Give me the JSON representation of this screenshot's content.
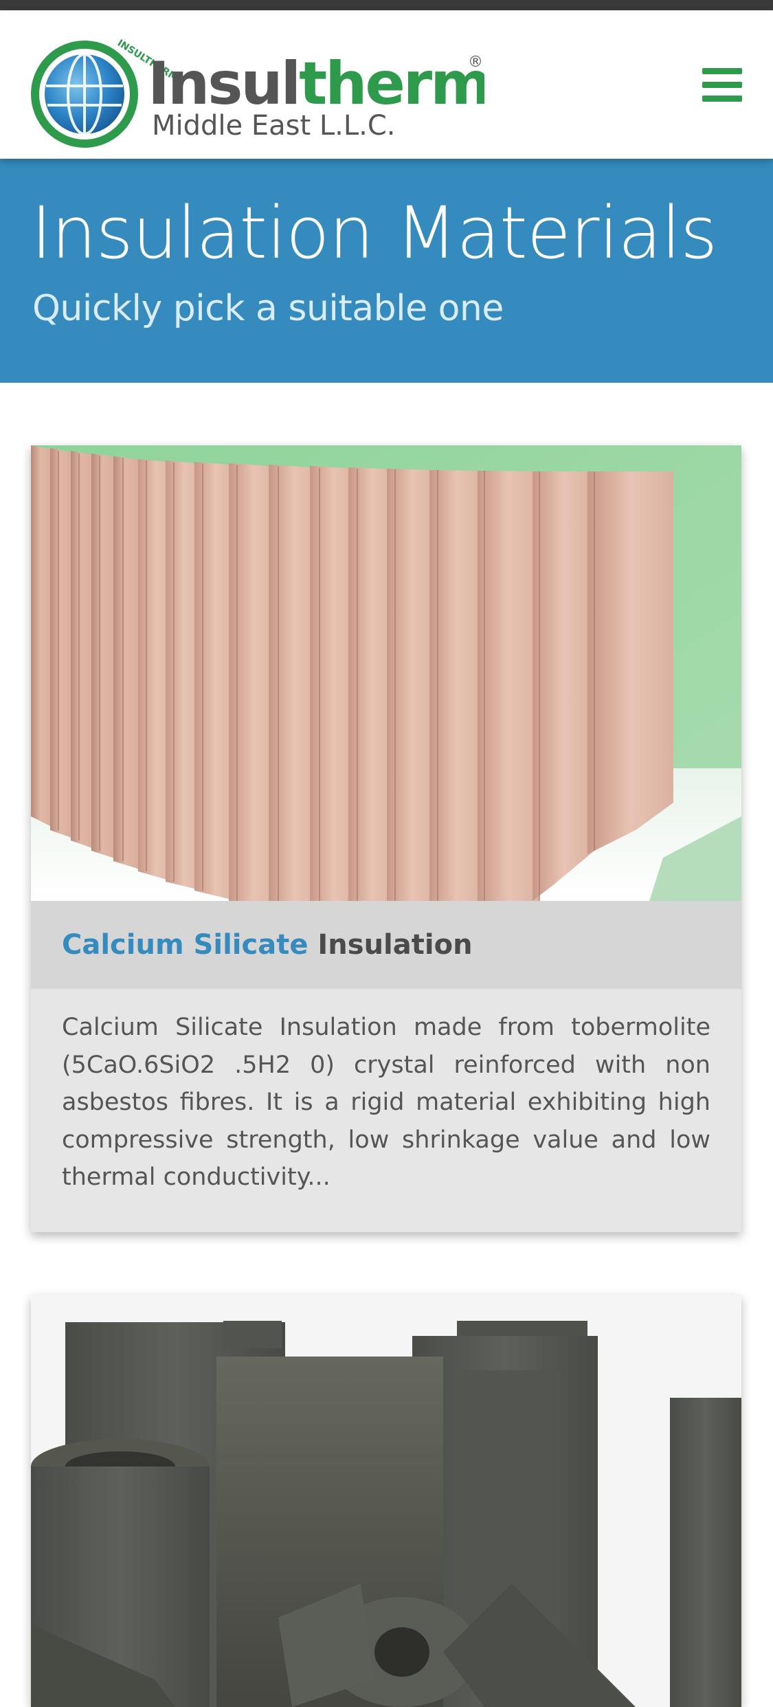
{
  "header": {
    "logo_text_insul": "Insul",
    "logo_text_therm": "therm",
    "logo_registered": "®",
    "logo_tagline": "Middle East L.L.C.",
    "logo_arc_text": "INSULTHERM",
    "menu_icon": "hamburger-menu-icon",
    "menu_color": "#2e9a4b"
  },
  "hero": {
    "title": "Insulation Materials",
    "subtitle": "Quickly pick a suitable one",
    "background_color": "#358bbd"
  },
  "products": [
    {
      "title_accent": "Calcium Silicate",
      "title_rest": "Insulation",
      "description": "Calcium Silicate Insulation made from tobermolite (5CaO.6SiO2 .5H2 0) crystal reinforced with non asbestos fibres. It is a rigid material exhibiting high compressive strength, low shrinkage value and low thermal conductivity..."
    },
    {
      "title_accent": "",
      "title_rest": "",
      "description": ""
    }
  ]
}
